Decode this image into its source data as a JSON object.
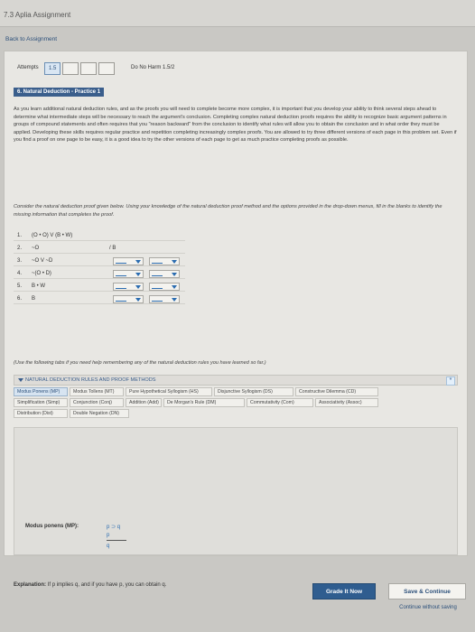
{
  "app": {
    "title": "7.3 Aplia Assignment",
    "back_link": "Back to Assignment"
  },
  "attempts": {
    "label": "Attempts",
    "current": "1.5",
    "do_no_harm": "Do No Harm 1.5/2"
  },
  "section": {
    "tag": "6. Natural Deduction - Practice 1"
  },
  "intro": {
    "text": "As you learn additional natural deduction rules, and as the proofs you will need to complete become more complex, it is important that you develop your ability to think several steps ahead to determine what intermediate steps will be necessary to reach the argument's conclusion. Completing complex natural deduction proofs requires the ability to recognize basic argument patterns in groups of compound statements and often requires that you \"reason backward\" from the conclusion to identify what rules will allow you to obtain the conclusion and in what order they must be applied. Developing these skills requires regular practice and repetition completing increasingly complex proofs. You are allowed to try three different versions of each page in this problem set. Even if you find a proof on one page to be easy, it is a good idea to try the other versions of each page to get as much practice completing proofs as possible."
  },
  "instructions": {
    "text": "Consider the natural deduction proof given below. Using your knowledge of the natural deduction proof method and the options provided in the drop-down menus, fill in the blanks to identify the missing information that completes the proof."
  },
  "proof": {
    "rows": [
      {
        "num": "1.",
        "stmt": "(O • O) V (B • W)",
        "just": ""
      },
      {
        "num": "2.",
        "stmt": "~O",
        "just": "/ B"
      },
      {
        "num": "3.",
        "stmt": "~O V ~D",
        "just": ""
      },
      {
        "num": "4.",
        "stmt": "~(O • D)",
        "just": ""
      },
      {
        "num": "5.",
        "stmt": "B • W",
        "just": ""
      },
      {
        "num": "6.",
        "stmt": "B",
        "just": ""
      }
    ]
  },
  "use_following": "(Use the following tabs if you need help remembering any of the natural deduction rules you have learned so far.)",
  "rules": {
    "header": "NATURAL DEDUCTION RULES AND PROOF METHODS",
    "star": "*",
    "tabs": [
      "Modus Ponens (MP)",
      "Modus Tollens (MT)",
      "Pure Hypothetical Syllogism (HS)",
      "Disjunctive Syllogism (DS)",
      "Constructive Dilemma (CD)",
      "Simplification (Simp)",
      "Conjunction (Conj)",
      "Addition (Add)",
      "De Morgan's Rule (DM)",
      "Commutativity (Com)",
      "Associativity (Assoc)",
      "Distribution (Dist)",
      "Double Negation (DN)"
    ]
  },
  "rule_panel": {
    "name": "Modus ponens (MP):",
    "line1": "p ⊃ q",
    "line2": "p",
    "line3": "q"
  },
  "explanation": {
    "label": "Explanation:",
    "text": "If p implies q, and if you have p, you can obtain q."
  },
  "buttons": {
    "grade": "Grade It Now",
    "save": "Save & Continue",
    "continue": "Continue without saving"
  }
}
